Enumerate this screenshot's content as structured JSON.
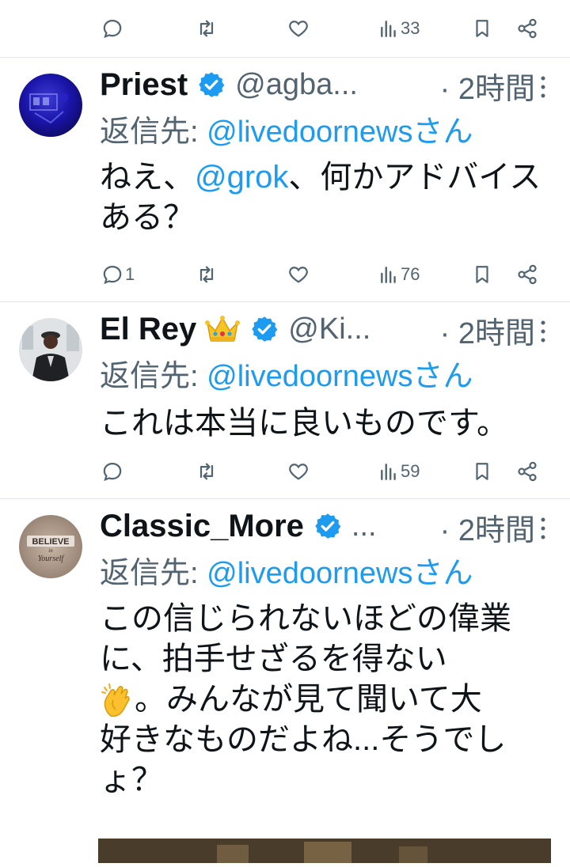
{
  "top_actions": {
    "views": "33"
  },
  "posts": [
    {
      "name": "Priest",
      "handle": "@agba...",
      "time": "· 2時間",
      "reply_label": "返信先:",
      "reply_to": "@livedoornewsさん",
      "text_before": "ねえ、",
      "text_mention": "@grok",
      "text_after": "、何かアドバイスある？",
      "reply_count": "1",
      "views": "76",
      "verified": true,
      "avatar_icon": "dark-blue-photo-avatar"
    },
    {
      "name": "El Rey",
      "name_emoji": "crown-emoji",
      "handle": "@Ki...",
      "time": "· 2時間",
      "reply_label": "返信先:",
      "reply_to": "@livedoornewsさん",
      "text": "これは本当に良いものです。",
      "reply_count": "",
      "views": "59",
      "verified": true,
      "avatar_icon": "man-in-suit-avatar"
    },
    {
      "name": "Classic_More",
      "handle": "...",
      "time": "· 2時間",
      "reply_label": "返信先:",
      "reply_to": "@livedoornewsさん",
      "text_line1": "この信じられないほどの偉業",
      "text_line2": "に、拍手せざるを得ない",
      "text_line3": "。みんなが見て聞いて大",
      "text_line4": "好きなものだよね...そうでし",
      "text_line5": "ょ？",
      "text_emoji": "clapping-hands-emoji",
      "avatar_text_1": "BELIEVE",
      "avatar_text_2": "in",
      "avatar_text_3": "Yourself",
      "verified": true
    }
  ],
  "colors": {
    "accent": "#1d9bf0",
    "secondary_text": "#536471",
    "divider": "#e1e4e8"
  }
}
